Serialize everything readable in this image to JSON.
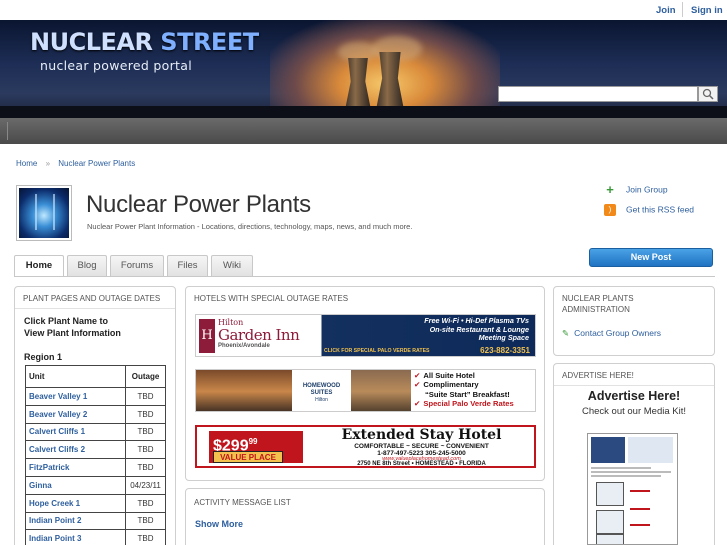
{
  "topbar": {
    "join": "Join",
    "signin": "Sign in"
  },
  "banner": {
    "logo_part1": "NUCLEAR",
    "logo_part2": "STREET",
    "tagline": "nuclear powered portal",
    "search_placeholder": ""
  },
  "breadcrumb": {
    "home": "Home",
    "separator": "»",
    "current": "Nuclear Power Plants"
  },
  "group": {
    "title": "Nuclear Power Plants",
    "description": "Nuclear Power Plant Information - Locations, directions, technology, maps, news, and much more.",
    "join_group": "Join Group",
    "rss": "Get this RSS feed"
  },
  "tabs": [
    "Home",
    "Blog",
    "Forums",
    "Files",
    "Wiki"
  ],
  "new_post": "New Post",
  "left_panel": {
    "header": "PLANT PAGES AND OUTAGE DATES",
    "intro_line1": "Click Plant Name to",
    "intro_line2": "View Plant Information",
    "region": "Region 1",
    "col_unit": "Unit",
    "col_outage": "Outage",
    "rows": [
      {
        "unit": "Beaver Valley 1",
        "outage": "TBD"
      },
      {
        "unit": "Beaver Valley 2",
        "outage": "TBD"
      },
      {
        "unit": "Calvert Cliffs 1",
        "outage": "TBD"
      },
      {
        "unit": "Calvert Cliffs 2",
        "outage": "TBD"
      },
      {
        "unit": "FitzPatrick",
        "outage": "TBD"
      },
      {
        "unit": "Ginna",
        "outage": "04/23/11"
      },
      {
        "unit": "Hope Creek 1",
        "outage": "TBD"
      },
      {
        "unit": "Indian Point 2",
        "outage": "TBD"
      },
      {
        "unit": "Indian Point 3",
        "outage": "TBD"
      }
    ]
  },
  "hotels": {
    "header": "HOTELS WITH SPECIAL OUTAGE RATES",
    "ad1": {
      "brand_small": "Hilton",
      "brand_big": "Garden Inn",
      "location": "Phoenix/Avondale",
      "line1": "Free Wi-Fi • Hi-Def Plasma TVs",
      "line2": "On-site Restaurant & Lounge",
      "line3": "Meeting Space",
      "cta": "CLICK FOR SPECIAL PALO VERDE RATES",
      "phone": "623-882-3351"
    },
    "ad2": {
      "brand": "HOMEWOOD SUITES",
      "sub": "Hilton",
      "item1": "All Suite Hotel",
      "item2": "Complimentary",
      "item3": "“Suite Start” Breakfast!",
      "item4": "Special Palo Verde Rates"
    },
    "ad3": {
      "price": "$299",
      "price_sup": "99",
      "brand": "VALUE PLACE",
      "title": "Extended Stay Hotel",
      "tagline": "COMFORTABLE ~ SECURE ~ CONVENIENT",
      "phones": "1-877-497-5223          305-245-5000",
      "url": "www.valueplacehomestead.com",
      "address": "2750 NE 8th Street  •  HOMESTEAD  •  FLORIDA"
    }
  },
  "activity": {
    "header": "ACTIVITY MESSAGE LIST",
    "show_more": "Show More"
  },
  "admin": {
    "header": "NUCLEAR PLANTS ADMINISTRATION",
    "contact": "Contact Group Owners"
  },
  "advertise": {
    "header": "ADVERTISE HERE!",
    "title": "Advertise Here!",
    "subtitle": "Check out our Media Kit!"
  },
  "colors": {
    "link": "#2e5f9e",
    "accent": "#1f73c2",
    "red": "#c0151c"
  }
}
